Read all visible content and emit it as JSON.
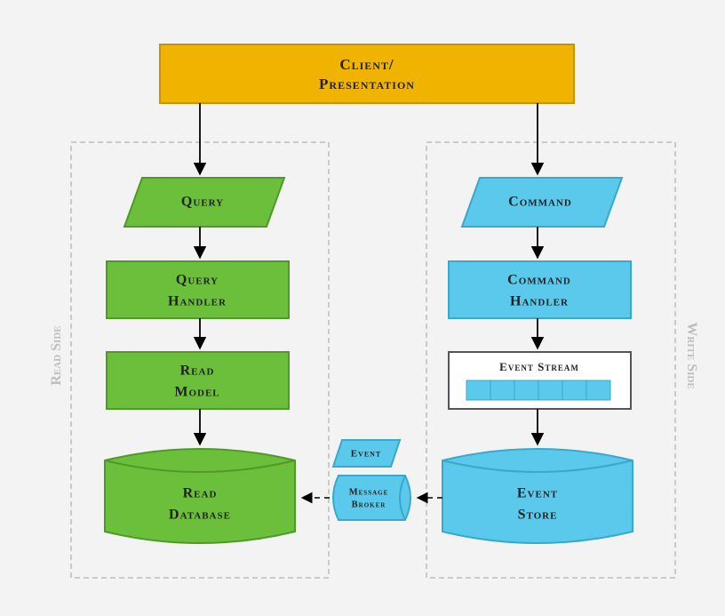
{
  "title": {
    "line1": "Client/",
    "line2": "Presentation"
  },
  "read": {
    "label": "Read Side",
    "query": "Query",
    "handler": {
      "line1": "Query",
      "line2": "Handler"
    },
    "model": {
      "line1": "Read",
      "line2": "Model"
    },
    "db": {
      "line1": "Read",
      "line2": "Database"
    }
  },
  "write": {
    "label": "Write Side",
    "command": "Command",
    "handler": {
      "line1": "Command",
      "line2": "Handler"
    },
    "stream": "Event Stream",
    "store": {
      "line1": "Event",
      "line2": "Store"
    }
  },
  "event": {
    "label": "Event",
    "broker": {
      "line1": "Message",
      "line2": "Broker"
    }
  },
  "colors": {
    "yellow": "#f0b400",
    "yellowStroke": "#c79400",
    "green": "#6bbf3b",
    "greenStroke": "#4f9a27",
    "blue": "#5bc9eb",
    "blueStroke": "#38a8cc",
    "grey": "#bdbdbd"
  }
}
